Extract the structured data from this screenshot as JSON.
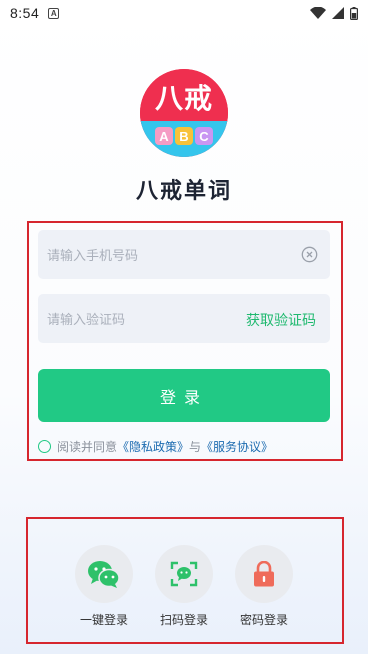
{
  "status_bar": {
    "time": "8:54",
    "notification_badge": "A"
  },
  "logo": {
    "top_text": "八戒",
    "letters": [
      "A",
      "B",
      "C"
    ]
  },
  "app_name": "八戒单词",
  "phone_input": {
    "placeholder": "请输入手机号码"
  },
  "code_input": {
    "placeholder": "请输入验证码",
    "get_code_label": "获取验证码"
  },
  "login_button": "登录",
  "agreement": {
    "prefix": "阅读并同意",
    "privacy": "《隐私政策》",
    "and": "与",
    "service": "《服务协议》"
  },
  "quick_login": [
    {
      "label": "一键登录",
      "icon": "wechat-icon"
    },
    {
      "label": "扫码登录",
      "icon": "scan-icon"
    },
    {
      "label": "密码登录",
      "icon": "lock-icon"
    }
  ],
  "colors": {
    "accent": "#21c985",
    "link": "#1c6bb0",
    "highlight_box": "#d6262e"
  }
}
